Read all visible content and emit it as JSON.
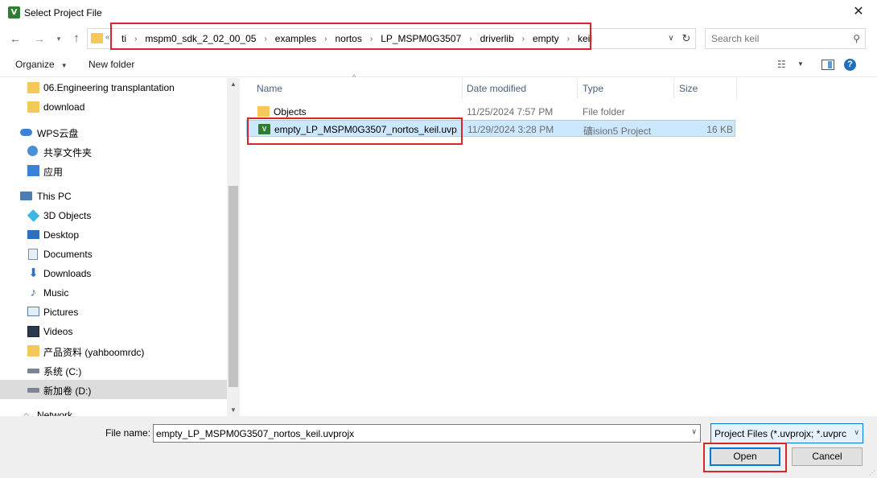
{
  "window": {
    "title": "Select Project File",
    "app_icon_glyph": "V",
    "close_glyph": "✕"
  },
  "address": {
    "overflow_glyph": "«",
    "breadcrumbs": [
      "ti",
      "mspm0_sdk_2_02_00_05",
      "examples",
      "nortos",
      "LP_MSPM0G3507",
      "driverlib",
      "empty",
      "keil"
    ],
    "separator_glyph": "›"
  },
  "search": {
    "placeholder": "Search keil"
  },
  "toolbar": {
    "organize_label": "Organize",
    "new_folder_label": "New folder"
  },
  "nav": {
    "items": [
      {
        "label": "06.Engineering transplantation",
        "icon": "folder-icon"
      },
      {
        "label": "download",
        "icon": "folder-icon"
      },
      {
        "label": "WPS云盘",
        "icon": "cloud-icon"
      },
      {
        "label": "共享文件夹",
        "icon": "share-icon"
      },
      {
        "label": "应用",
        "icon": "apps-icon"
      },
      {
        "label": "This PC",
        "icon": "pc-icon"
      },
      {
        "label": "3D Objects",
        "icon": "3d-objects-icon"
      },
      {
        "label": "Desktop",
        "icon": "desktop-icon"
      },
      {
        "label": "Documents",
        "icon": "documents-icon"
      },
      {
        "label": "Downloads",
        "icon": "downloads-icon"
      },
      {
        "label": "Music",
        "icon": "music-icon"
      },
      {
        "label": "Pictures",
        "icon": "pictures-icon"
      },
      {
        "label": "Videos",
        "icon": "videos-icon"
      },
      {
        "label": "产品资料 (yahboomrdc)",
        "icon": "folder-icon"
      },
      {
        "label": "系统 (C:)",
        "icon": "drive-icon"
      },
      {
        "label": "新加卷 (D:)",
        "icon": "drive-icon"
      },
      {
        "label": "Network",
        "icon": "network-icon"
      }
    ],
    "selected": "新加卷 (D:)"
  },
  "columns": {
    "name": "Name",
    "date": "Date modified",
    "type": "Type",
    "size": "Size"
  },
  "files": [
    {
      "name": "Objects",
      "date": "11/25/2024 7:57 PM",
      "type": "File folder",
      "size": "",
      "icon": "folder-icon"
    },
    {
      "name": "empty_LP_MSPM0G3507_nortos_keil.uvp...",
      "date": "11/29/2024 3:28 PM",
      "type": "礦ision5 Project",
      "size": "16 KB",
      "icon": "uvision-project-icon"
    }
  ],
  "bottom": {
    "file_name_label": "File name:",
    "file_name_value": "empty_LP_MSPM0G3507_nortos_keil.uvprojx",
    "filter_value": "Project Files (*.uvprojx; *.uvprc",
    "open_label": "Open",
    "cancel_label": "Cancel"
  },
  "colors": {
    "highlight": "#d9232d",
    "selection": "#cce8ff",
    "accent": "#0078d7"
  }
}
